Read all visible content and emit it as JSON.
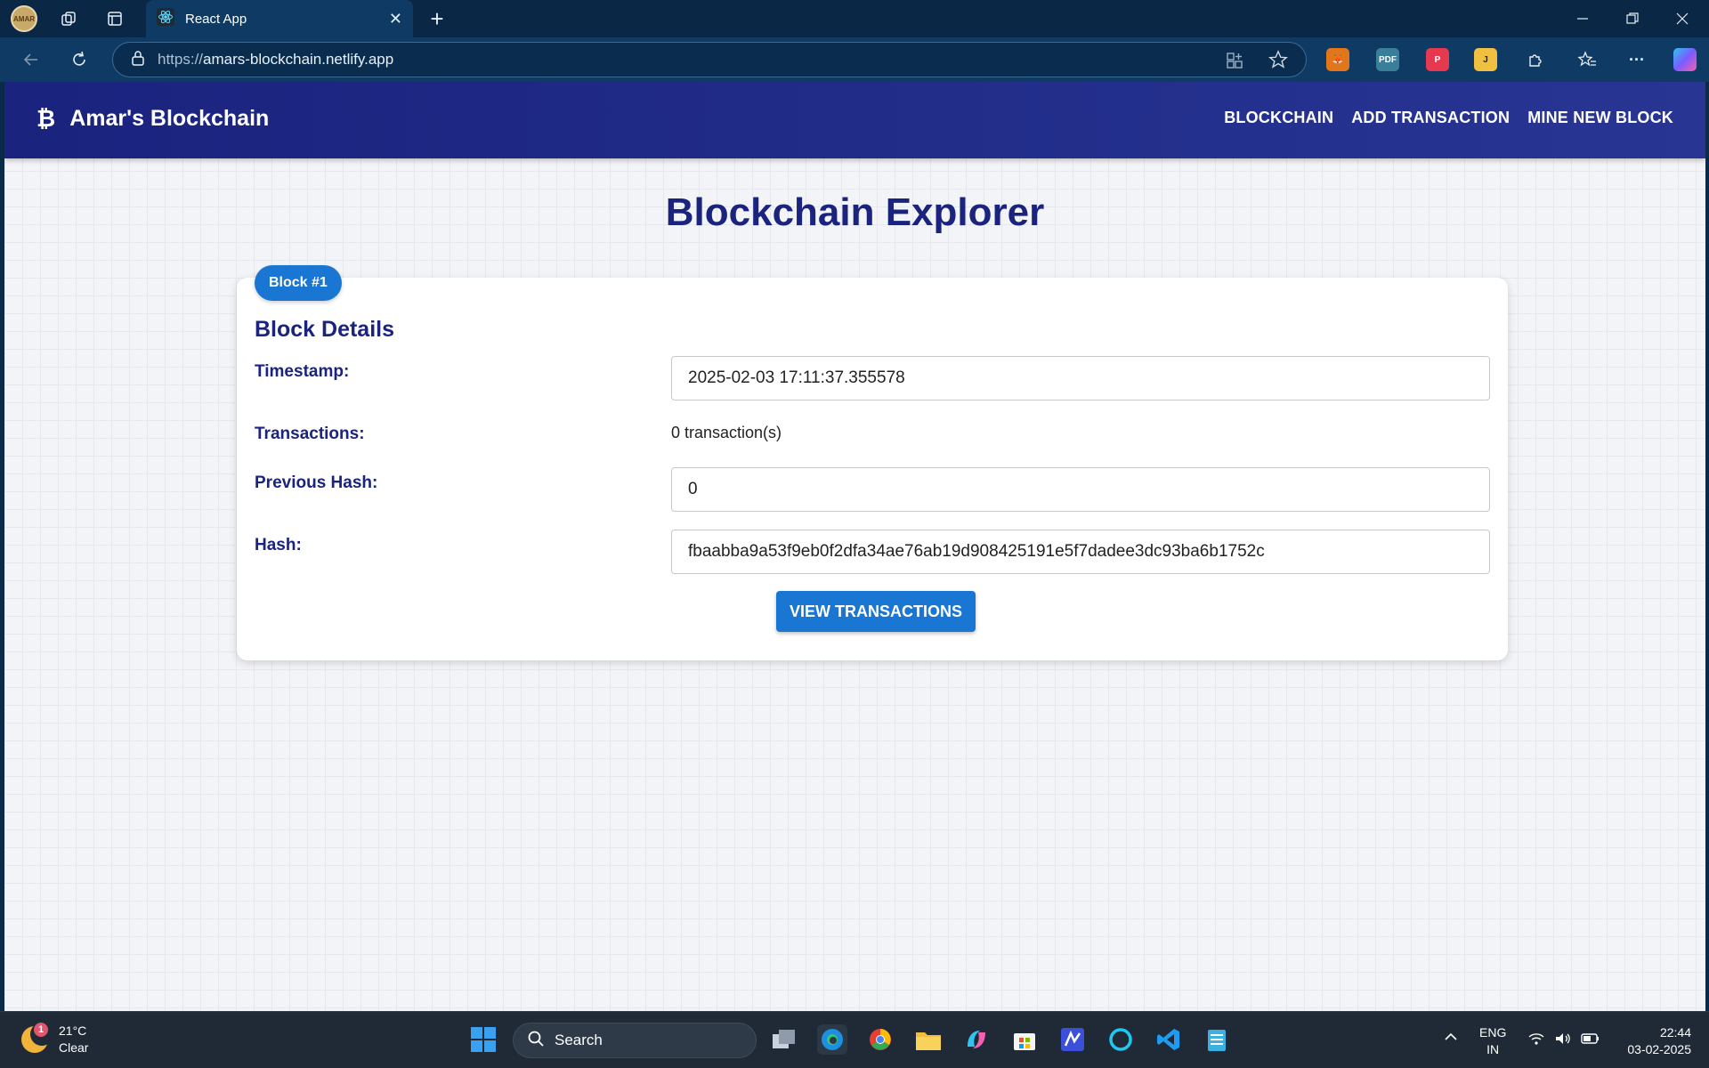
{
  "browser": {
    "tab_title": "React App",
    "url_prefix": "https://",
    "url_domain": "amars-blockchain.netlify.app",
    "profile_label": "AMAR"
  },
  "app": {
    "brand_icon": "₿",
    "brand_name": "Amar's Blockchain",
    "nav": [
      "BLOCKCHAIN",
      "ADD TRANSACTION",
      "MINE NEW BLOCK"
    ]
  },
  "explorer": {
    "heading": "Blockchain Explorer",
    "block_badge": "Block #1",
    "card_title": "Block Details",
    "timestamp_label": "Timestamp:",
    "timestamp_value": "2025-02-03 17:11:37.355578",
    "transactions_label": "Transactions:",
    "transactions_value": "0 transaction(s)",
    "prev_hash_label": "Previous Hash:",
    "prev_hash_value": "0",
    "hash_label": "Hash:",
    "hash_value": "fbaabba9a53f9eb0f2dfa34ae76ab19d908425191e5f7dadee3dc93ba6b1752c",
    "view_button": "VIEW TRANSACTIONS"
  },
  "taskbar": {
    "weather_badge": "1",
    "temperature": "21°C",
    "condition": "Clear",
    "search_placeholder": "Search",
    "lang_top": "ENG",
    "lang_bottom": "IN",
    "time": "22:44",
    "date": "03-02-2025"
  },
  "colors": {
    "appbar": "#1a237e",
    "primary": "#1976d2",
    "heading": "#1a237e"
  }
}
